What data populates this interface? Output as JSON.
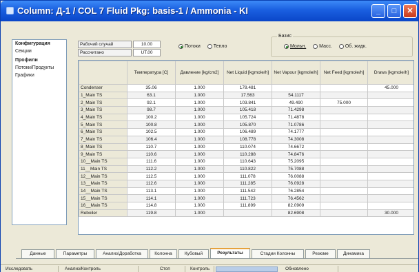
{
  "window": {
    "title": "Column: Д-1 / COL 7  Fluid Pkg: basis-1 / Ammonia - KI",
    "minimize_glyph": "_",
    "maximize_glyph": "□",
    "close_glyph": "✕"
  },
  "left_panel": {
    "items": [
      "Конфигурация",
      "Секции",
      "Профили",
      "Потоки/Продукты",
      "Графики"
    ]
  },
  "params": {
    "rows": [
      {
        "label": "Рабочий случай",
        "value": "10.00"
      },
      {
        "label": "Рассчитано",
        "value": "UT.00"
      }
    ]
  },
  "radio_flow": {
    "options": [
      {
        "label": "Потоки",
        "selected": true
      },
      {
        "label": "Тепло",
        "selected": false
      }
    ]
  },
  "basis_group": {
    "title": "Базис",
    "options": [
      {
        "label": "Мольн.",
        "selected": true
      },
      {
        "label": "Масс.",
        "selected": false
      },
      {
        "label": "Об. жидк.",
        "selected": false
      }
    ]
  },
  "table": {
    "headers": [
      "",
      "Температура [C]",
      "Давление [kg/cm2]",
      "Net Liquid [kgmole/h]",
      "Net Vapour [kgmole/h]",
      "Net Feed [kgmole/h]",
      "Draws [kgmole/h]"
    ],
    "rows": [
      {
        "stage": "Condenser",
        "temp": "35.06",
        "press": "1.000",
        "liq": "178.481",
        "vap": "",
        "feed": "",
        "draw": "45.000"
      },
      {
        "stage": "1_Main TS",
        "temp": "63.1",
        "press": "1.000",
        "liq": "17.563",
        "vap": "54.1117",
        "feed": "",
        "draw": ""
      },
      {
        "stage": "2_Main TS",
        "temp": "92.1",
        "press": "1.000",
        "liq": "103.841",
        "vap": "49.490",
        "feed": "75.000",
        "draw": ""
      },
      {
        "stage": "3_Main TS",
        "temp": "98.7",
        "press": "1.000",
        "liq": "105.418",
        "vap": "71.4298",
        "feed": "",
        "draw": ""
      },
      {
        "stage": "4_Main TS",
        "temp": "100.2",
        "press": "1.000",
        "liq": "105.724",
        "vap": "71.4878",
        "feed": "",
        "draw": ""
      },
      {
        "stage": "5_Main TS",
        "temp": "100.8",
        "press": "1.000",
        "liq": "105.870",
        "vap": "71.0786",
        "feed": "",
        "draw": ""
      },
      {
        "stage": "6_Main TS",
        "temp": "102.5",
        "press": "1.000",
        "liq": "106.489",
        "vap": "74.1777",
        "feed": "",
        "draw": ""
      },
      {
        "stage": "7_Main TS",
        "temp": "106.4",
        "press": "1.000",
        "liq": "108.778",
        "vap": "74.3008",
        "feed": "",
        "draw": ""
      },
      {
        "stage": "8_Main TS",
        "temp": "110.7",
        "press": "1.000",
        "liq": "110.074",
        "vap": "74.6672",
        "feed": "",
        "draw": ""
      },
      {
        "stage": "9_Main TS",
        "temp": "110.6",
        "press": "1.000",
        "liq": "110.288",
        "vap": "74.8476",
        "feed": "",
        "draw": ""
      },
      {
        "stage": "10__Main TS",
        "temp": "111.6",
        "press": "1.000",
        "liq": "110.643",
        "vap": "75.2095",
        "feed": "",
        "draw": ""
      },
      {
        "stage": "11__Main TS",
        "temp": "112.2",
        "press": "1.000",
        "liq": "110.822",
        "vap": "75.7088",
        "feed": "",
        "draw": ""
      },
      {
        "stage": "12__Main TS",
        "temp": "112.5",
        "press": "1.000",
        "liq": "111.078",
        "vap": "76.0088",
        "feed": "",
        "draw": ""
      },
      {
        "stage": "13__Main TS",
        "temp": "112.6",
        "press": "1.000",
        "liq": "111.285",
        "vap": "76.0928",
        "feed": "",
        "draw": ""
      },
      {
        "stage": "14__Main TS",
        "temp": "113.1",
        "press": "1.000",
        "liq": "111.542",
        "vap": "76.2854",
        "feed": "",
        "draw": ""
      },
      {
        "stage": "15__Main TS",
        "temp": "114.1",
        "press": "1.000",
        "liq": "111.723",
        "vap": "76.4562",
        "feed": "",
        "draw": ""
      },
      {
        "stage": "16__Main TS",
        "temp": "114.8",
        "press": "1.000",
        "liq": "111.899",
        "vap": "82.0909",
        "feed": "",
        "draw": ""
      },
      {
        "stage": "Reboiler",
        "temp": "119.8",
        "press": "1.000",
        "liq": "",
        "vap": "82.6908",
        "feed": "",
        "draw": "30.000"
      }
    ]
  },
  "tabs": [
    "Данные",
    "Параметры",
    "Анализ/Доработка",
    "Колонна",
    "Кубовый",
    "Результаты",
    "Стадии Колонны",
    "Резюме",
    "Динамика"
  ],
  "active_tab_index": 5,
  "status": {
    "left": "Исследовать",
    "mid": "Анализ/Контроль",
    "right1": "Стоп",
    "right2": "Контроль",
    "right3": "Обновлено"
  }
}
